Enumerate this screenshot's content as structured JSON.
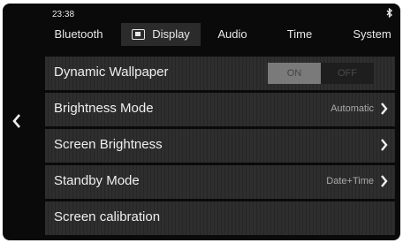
{
  "status": {
    "time": "23:38",
    "bluetooth_icon": "bluetooth-icon"
  },
  "tabs": [
    {
      "label": "Bluetooth",
      "active": false
    },
    {
      "label": "Display",
      "active": true,
      "icon": "display-icon"
    },
    {
      "label": "Audio",
      "active": false
    },
    {
      "label": "Time",
      "active": false
    },
    {
      "label": "System",
      "active": false
    }
  ],
  "back_icon": "chevron-left-icon",
  "rows": [
    {
      "label": "Dynamic Wallpaper",
      "toggle": {
        "on": "ON",
        "off": "OFF",
        "state": "on"
      }
    },
    {
      "label": "Brightness Mode",
      "value": "Automatic"
    },
    {
      "label": "Screen Brightness",
      "value": ""
    },
    {
      "label": "Standby Mode",
      "value": "Date+Time"
    },
    {
      "label": "Screen calibration"
    }
  ]
}
